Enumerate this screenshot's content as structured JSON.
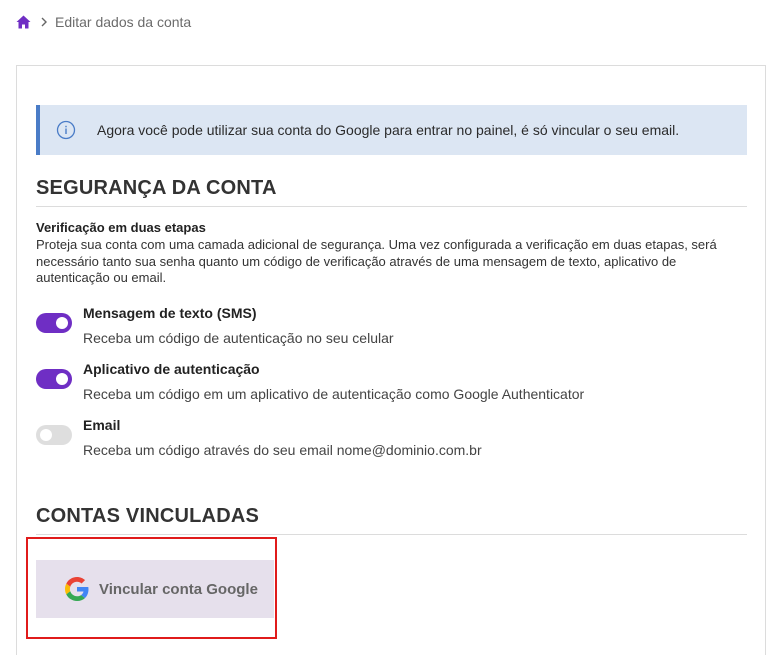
{
  "breadcrumb": {
    "home_icon": "home-icon",
    "separator_icon": "chevron-right-icon",
    "current": "Editar dados da conta"
  },
  "alert": {
    "icon": "info-icon",
    "text": "Agora você pode utilizar sua conta do Google para entrar no painel, é só vincular o seu email."
  },
  "security": {
    "title": "SEGURANÇA DA CONTA",
    "twofa_title": "Verificação em duas etapas",
    "twofa_desc": "Proteja sua conta com uma camada adicional de segurança. Uma vez configurada a verificação em duas etapas, será necessário tanto sua senha quanto um código de verificação através de uma mensagem de texto, aplicativo de autenticação ou email.",
    "options": [
      {
        "title": "Mensagem de texto (SMS)",
        "desc": "Receba um código de autenticação no seu celular",
        "enabled": true
      },
      {
        "title": "Aplicativo de autenticação",
        "desc": "Receba um código em um aplicativo de autenticação como Google Authenticator",
        "enabled": true
      },
      {
        "title": "Email",
        "desc": "Receba um código através do seu email nome@dominio.com.br",
        "enabled": false
      }
    ]
  },
  "linked": {
    "title": "CONTAS VINCULADAS",
    "google_button_label": "Vincular conta Google",
    "google_icon": "google-g-icon"
  },
  "colors": {
    "accent": "#6f2ec4",
    "alert_bg": "#dce6f3",
    "alert_border": "#4a7cc7",
    "highlight": "#e01b1b",
    "button_bg": "#e6e0ec"
  }
}
